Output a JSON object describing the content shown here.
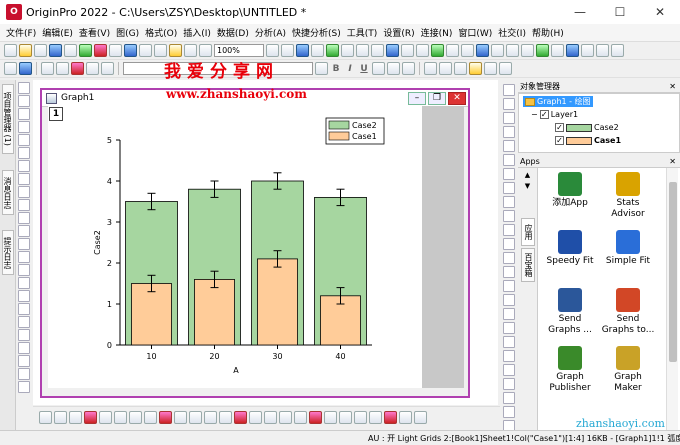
{
  "window": {
    "title": "OriginPro 2022 - C:\\Users\\ZSY\\Desktop\\UNTITLED *",
    "min_icon": "minimize-icon",
    "max_icon": "maximize-icon",
    "close_icon": "close-icon"
  },
  "menubar": {
    "items": [
      "文件(F)",
      "编辑(E)",
      "查看(V)",
      "图(G)",
      "格式(O)",
      "插入(I)",
      "数据(D)",
      "分析(A)",
      "快捷分析(S)",
      "工具(T)",
      "设置(R)",
      "连接(N)",
      "窗口(W)",
      "社交(I)",
      "帮助(H)"
    ]
  },
  "toolbar": {
    "zoom": "100%",
    "bold": "B",
    "italic": "I",
    "underline": "U"
  },
  "watermark": {
    "cn_text": "我爱分享网",
    "url_top": "www.zhanshaoyi.com",
    "url_bottom": "zhanshaoyi.com"
  },
  "left_dock": {
    "tabs": [
      "项目管理器 (1)",
      "消息日志",
      "提示日志"
    ]
  },
  "graph_window": {
    "title": "Graph1",
    "layer_number": "1"
  },
  "chart_data": {
    "type": "bar",
    "categories": [
      "10",
      "20",
      "30",
      "40"
    ],
    "series": [
      {
        "name": "Case2",
        "values": [
          3.5,
          3.8,
          4.0,
          3.6
        ],
        "errors": [
          0.2,
          0.2,
          0.2,
          0.2
        ],
        "color": "#a6d6a0"
      },
      {
        "name": "Case1",
        "values": [
          1.5,
          1.6,
          2.1,
          1.2
        ],
        "errors": [
          0.2,
          0.2,
          0.2,
          0.2
        ],
        "color": "#ffcc99"
      }
    ],
    "xlabel": "A",
    "ylabel": "Case2",
    "ylim": [
      0,
      5
    ],
    "yticks": [
      "0",
      "1",
      "2",
      "3",
      "4",
      "5"
    ],
    "legend_position": "top-right",
    "grid": false
  },
  "object_manager": {
    "title": "对象管理器",
    "root": "Graph1 - 绘图",
    "layer": "Layer1",
    "plots": [
      {
        "label": "Case2",
        "color": "#a6d6a0"
      },
      {
        "label": "Case1",
        "color": "#ffcc99"
      }
    ]
  },
  "apps": {
    "title": "Apps",
    "side_tabs": [
      "应用",
      "百宝箱"
    ],
    "tiles": [
      {
        "label": "添加App",
        "icon": "add-app-icon",
        "color": "#2a8a3a"
      },
      {
        "label": "Stats\nAdvisor",
        "icon": "magic-wand-icon",
        "color": "#d9a300"
      },
      {
        "label": "Speedy Fit",
        "icon": "speedy-fit-icon",
        "color": "#1f4fa8"
      },
      {
        "label": "Simple Fit",
        "icon": "simple-fit-icon",
        "color": "#2a6ed8"
      },
      {
        "label": "Send\nGraphs ...",
        "icon": "word-doc-icon",
        "color": "#2b579a"
      },
      {
        "label": "Send\nGraphs to...",
        "icon": "ppt-doc-icon",
        "color": "#d24726"
      },
      {
        "label": "Graph\nPublisher",
        "icon": "graph-publisher-icon",
        "color": "#3a8a2a"
      },
      {
        "label": "Graph\nMaker",
        "icon": "graph-maker-icon",
        "color": "#c9a227"
      }
    ]
  },
  "statusbar": {
    "text": "AU : 开  Light Grids  2:[Book1]Sheet1!Col(\"Case1\")[1:4]  16KB - [Graph1]1!1  弧度"
  }
}
